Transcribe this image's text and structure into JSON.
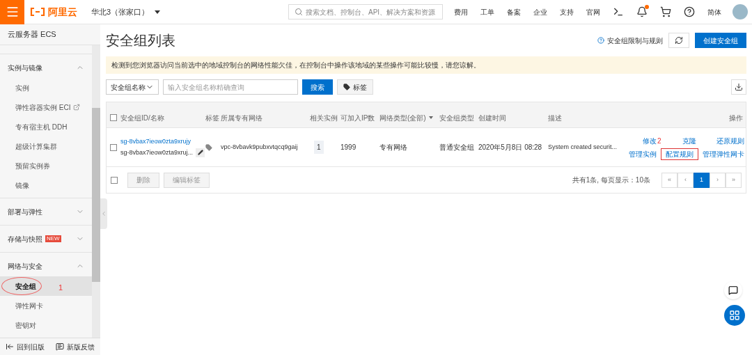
{
  "topbar": {
    "logo": "阿里云",
    "region": "华北3（张家口）",
    "search": {
      "placeholder": "搜索文档、控制台、API、解决方案和资源"
    },
    "links": [
      "费用",
      "工单",
      "备案",
      "企业",
      "支持",
      "官网"
    ],
    "notification_dot": true,
    "language": "简体"
  },
  "sidebar": {
    "title": "云服务器 ECS",
    "groups": [
      {
        "label": "实例与镜像",
        "expanded": true,
        "children": [
          {
            "label": "实例",
            "selected": false,
            "external": false
          },
          {
            "label": "弹性容器实例 ECI",
            "selected": false,
            "external": true
          },
          {
            "label": "专有宿主机 DDH",
            "selected": false,
            "external": false
          },
          {
            "label": "超级计算集群",
            "selected": false,
            "external": false
          },
          {
            "label": "预留实例券",
            "selected": false,
            "external": false
          },
          {
            "label": "镜像",
            "selected": false,
            "external": false
          }
        ]
      },
      {
        "label": "部署与弹性",
        "expanded": false
      },
      {
        "label": "存储与快照",
        "expanded": false,
        "badge": "NEW"
      },
      {
        "label": "网络与安全",
        "expanded": true,
        "children": [
          {
            "label": "安全组",
            "selected": true,
            "external": false,
            "annotation": "1"
          },
          {
            "label": "弹性网卡",
            "selected": false,
            "external": false
          },
          {
            "label": "密钥对",
            "selected": false,
            "external": false
          }
        ]
      }
    ],
    "footer": [
      "回到旧版",
      "新版反馈"
    ]
  },
  "page": {
    "title": "安全组列表",
    "help_link": "安全组限制与规则",
    "create_button": "创建安全组",
    "notice": "检测到您浏览器访问当前选中的地域控制台的网络性能欠佳，在控制台中操作该地域的某些操作可能比较慢，请您谅解。",
    "filter": {
      "field": "安全组名称",
      "placeholder": "输入安全组名称精确查询",
      "search_button": "搜索",
      "tag_button": "标签"
    },
    "table": {
      "select_all_checked": false,
      "columns": [
        "安全组ID/名称",
        "标签",
        "所属专有网络",
        "相关实例",
        "可加入IP数",
        "网络类型(全部)",
        "安全组类型",
        "创建时间",
        "描述",
        "操作"
      ],
      "rows": [
        {
          "checked": false,
          "id": "sg-8vbax7ieow0zta9xrujy",
          "name": "sg-8vbax7ieow0zta9xruj...",
          "vpc": "vpc-8vbavk9pubxvtqcq9gaij",
          "instances": "1",
          "ip_count": "1999",
          "network_type": "专有网络",
          "group_type": "普通安全组",
          "created": "2020年5月8日 08:28",
          "description": "System created securit...",
          "actions": [
            {
              "label": "修改",
              "highlighted": false
            },
            {
              "label": "克隆",
              "highlighted": false
            },
            {
              "label": "还原规则",
              "highlighted": false
            },
            {
              "label": "管理实例",
              "highlighted": false
            },
            {
              "label": "配置规则",
              "highlighted": true,
              "annotation": "2"
            },
            {
              "label": "管理弹性网卡",
              "highlighted": false
            }
          ]
        }
      ],
      "footer_select_all_checked": false,
      "bulk_buttons": [
        "删除",
        "编辑标签"
      ],
      "summary": "共有1条, 每页显示：10条",
      "pagination": [
        {
          "label": "«",
          "selected": false
        },
        {
          "label": "‹",
          "selected": false
        },
        {
          "label": "1",
          "selected": true
        },
        {
          "label": "›",
          "selected": false
        },
        {
          "label": "»",
          "selected": false
        }
      ]
    }
  }
}
